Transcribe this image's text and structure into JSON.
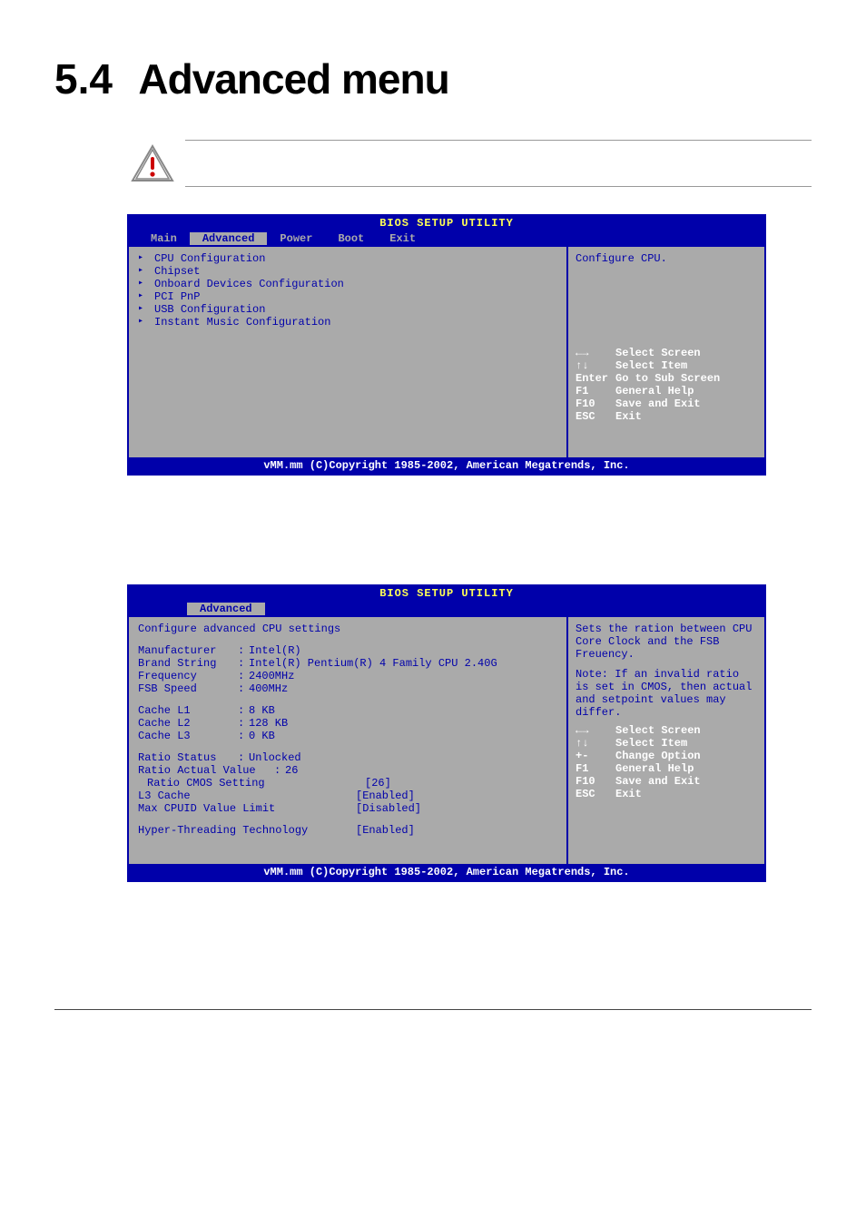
{
  "heading": {
    "num": "5.4",
    "text": "Advanced menu"
  },
  "bios": {
    "title": "BIOS SETUP UTILITY",
    "tabs": [
      "Main",
      "Advanced",
      "Power",
      "Boot",
      "Exit"
    ],
    "footer": "vMM.mm (C)Copyright 1985-2002, American Megatrends, Inc."
  },
  "window1": {
    "items": [
      "CPU Configuration",
      "Chipset",
      "Onboard Devices Configuration",
      "PCI PnP",
      "USB Configuration",
      "Instant Music Configuration"
    ],
    "help_top": "Configure CPU.",
    "help_keys": [
      {
        "k": "←→",
        "v": "Select Screen"
      },
      {
        "k": "↑↓",
        "v": "Select Item"
      },
      {
        "k": "Enter",
        "v": "Go to Sub Screen"
      },
      {
        "k": "F1",
        "v": "General Help"
      },
      {
        "k": "F10",
        "v": "Save and Exit"
      },
      {
        "k": "ESC",
        "v": "Exit"
      }
    ]
  },
  "window2": {
    "subtitle": "Configure advanced CPU settings",
    "info": {
      "Manufacturer": "Intel(R)",
      "Brand String": "Intel(R) Pentium(R) 4 Family CPU 2.40G",
      "Frequency": "2400MHz",
      "FSB Speed": "400MHz",
      "Cache L1": "8 KB",
      "Cache L2": "128 KB",
      "Cache L3": "0 KB",
      "Ratio Status": "Unlocked",
      "Ratio Actual Value": "26"
    },
    "options": [
      {
        "label": "Ratio CMOS Setting",
        "value": "[26]",
        "indent": true
      },
      {
        "label": "L3 Cache",
        "value": "[Enabled]"
      },
      {
        "label": "Max CPUID Value Limit",
        "value": "[Disabled]"
      },
      {
        "label": "Hyper-Threading Technology",
        "value": "[Enabled]",
        "gap": true
      }
    ],
    "help_top": "Sets the ration between CPU Core Clock and the FSB Freuency.",
    "help_note": "Note: If an invalid ratio is set in CMOS, then actual and setpoint values may differ.",
    "help_keys": [
      {
        "k": "←→",
        "v": "Select Screen"
      },
      {
        "k": "↑↓",
        "v": "Select Item"
      },
      {
        "k": "+-",
        "v": "Change Option"
      },
      {
        "k": "F1",
        "v": "General Help"
      },
      {
        "k": "F10",
        "v": "Save and Exit"
      },
      {
        "k": "ESC",
        "v": "Exit"
      }
    ]
  }
}
